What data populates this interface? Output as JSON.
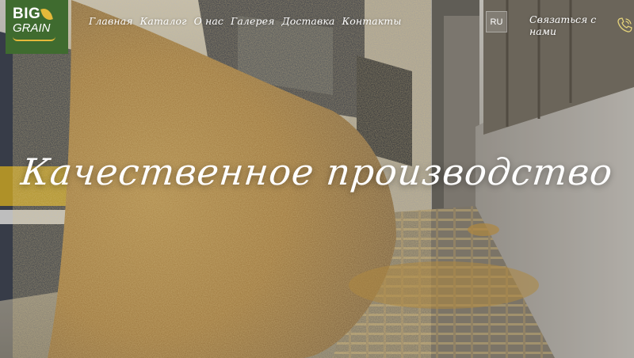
{
  "logo": {
    "line1": "BIG",
    "line2": "GRAIN"
  },
  "nav": {
    "items": [
      {
        "label": "Главная"
      },
      {
        "label": "Каталог"
      },
      {
        "label": "О нас"
      },
      {
        "label": "Галерея"
      },
      {
        "label": "Доставка"
      },
      {
        "label": "Контакты"
      }
    ]
  },
  "lang": {
    "current": "RU"
  },
  "contact": {
    "label": "Связаться с нами",
    "icon": "phone-icon"
  },
  "hero": {
    "headline": "Качественное производство"
  },
  "colors": {
    "logo_bg": "#3f6b2f",
    "accent": "#e5b93a",
    "text": "#ffffff"
  }
}
